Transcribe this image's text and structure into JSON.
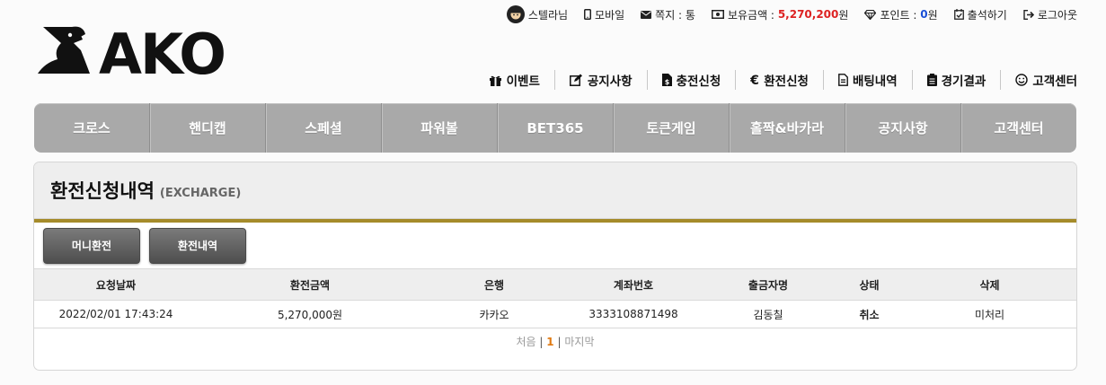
{
  "topbar": {
    "user": "스텔라님",
    "mobile": "모바일",
    "memo": "쪽지 : 통",
    "balance_label": "보유금액 :",
    "balance_value": "5,270,200",
    "balance_unit": "원",
    "point_label": "포인트 :",
    "point_value": "0",
    "point_unit": "원",
    "attendance": "출석하기",
    "logout": "로그아웃"
  },
  "logo": {
    "text": "AKO"
  },
  "subnav": [
    "이벤트",
    "공지사항",
    "충전신청",
    "환전신청",
    "배팅내역",
    "경기결과",
    "고객센터"
  ],
  "mainnav": [
    "크로스",
    "핸디캡",
    "스페셜",
    "파워볼",
    "BET365",
    "토큰게임",
    "홀짝&바카라",
    "공지사항",
    "고객센터"
  ],
  "panel": {
    "title": "환전신청내역",
    "subtitle": "(EXCHARGE)",
    "buttons": {
      "money_exchange": "머니환전",
      "exchange_history": "환전내역"
    },
    "table": {
      "headers": [
        "요청날짜",
        "환전금액",
        "은행",
        "계좌번호",
        "출금자명",
        "상태",
        "삭제"
      ],
      "rows": [
        [
          "2022/02/01 17:43:24",
          "5,270,000원",
          "카카오",
          "3333108871498",
          "김동칠",
          "취소",
          "미처리"
        ]
      ]
    },
    "pager": {
      "first": "처음",
      "sep": "|",
      "current": "1",
      "last": "마지막"
    }
  },
  "colors": {
    "menu_bg": "#a9a9a9",
    "accent_gold": "#a58b2a",
    "balance_red": "#dd2222",
    "point_blue": "#1a4fd6",
    "page_current": "#e07a12"
  }
}
